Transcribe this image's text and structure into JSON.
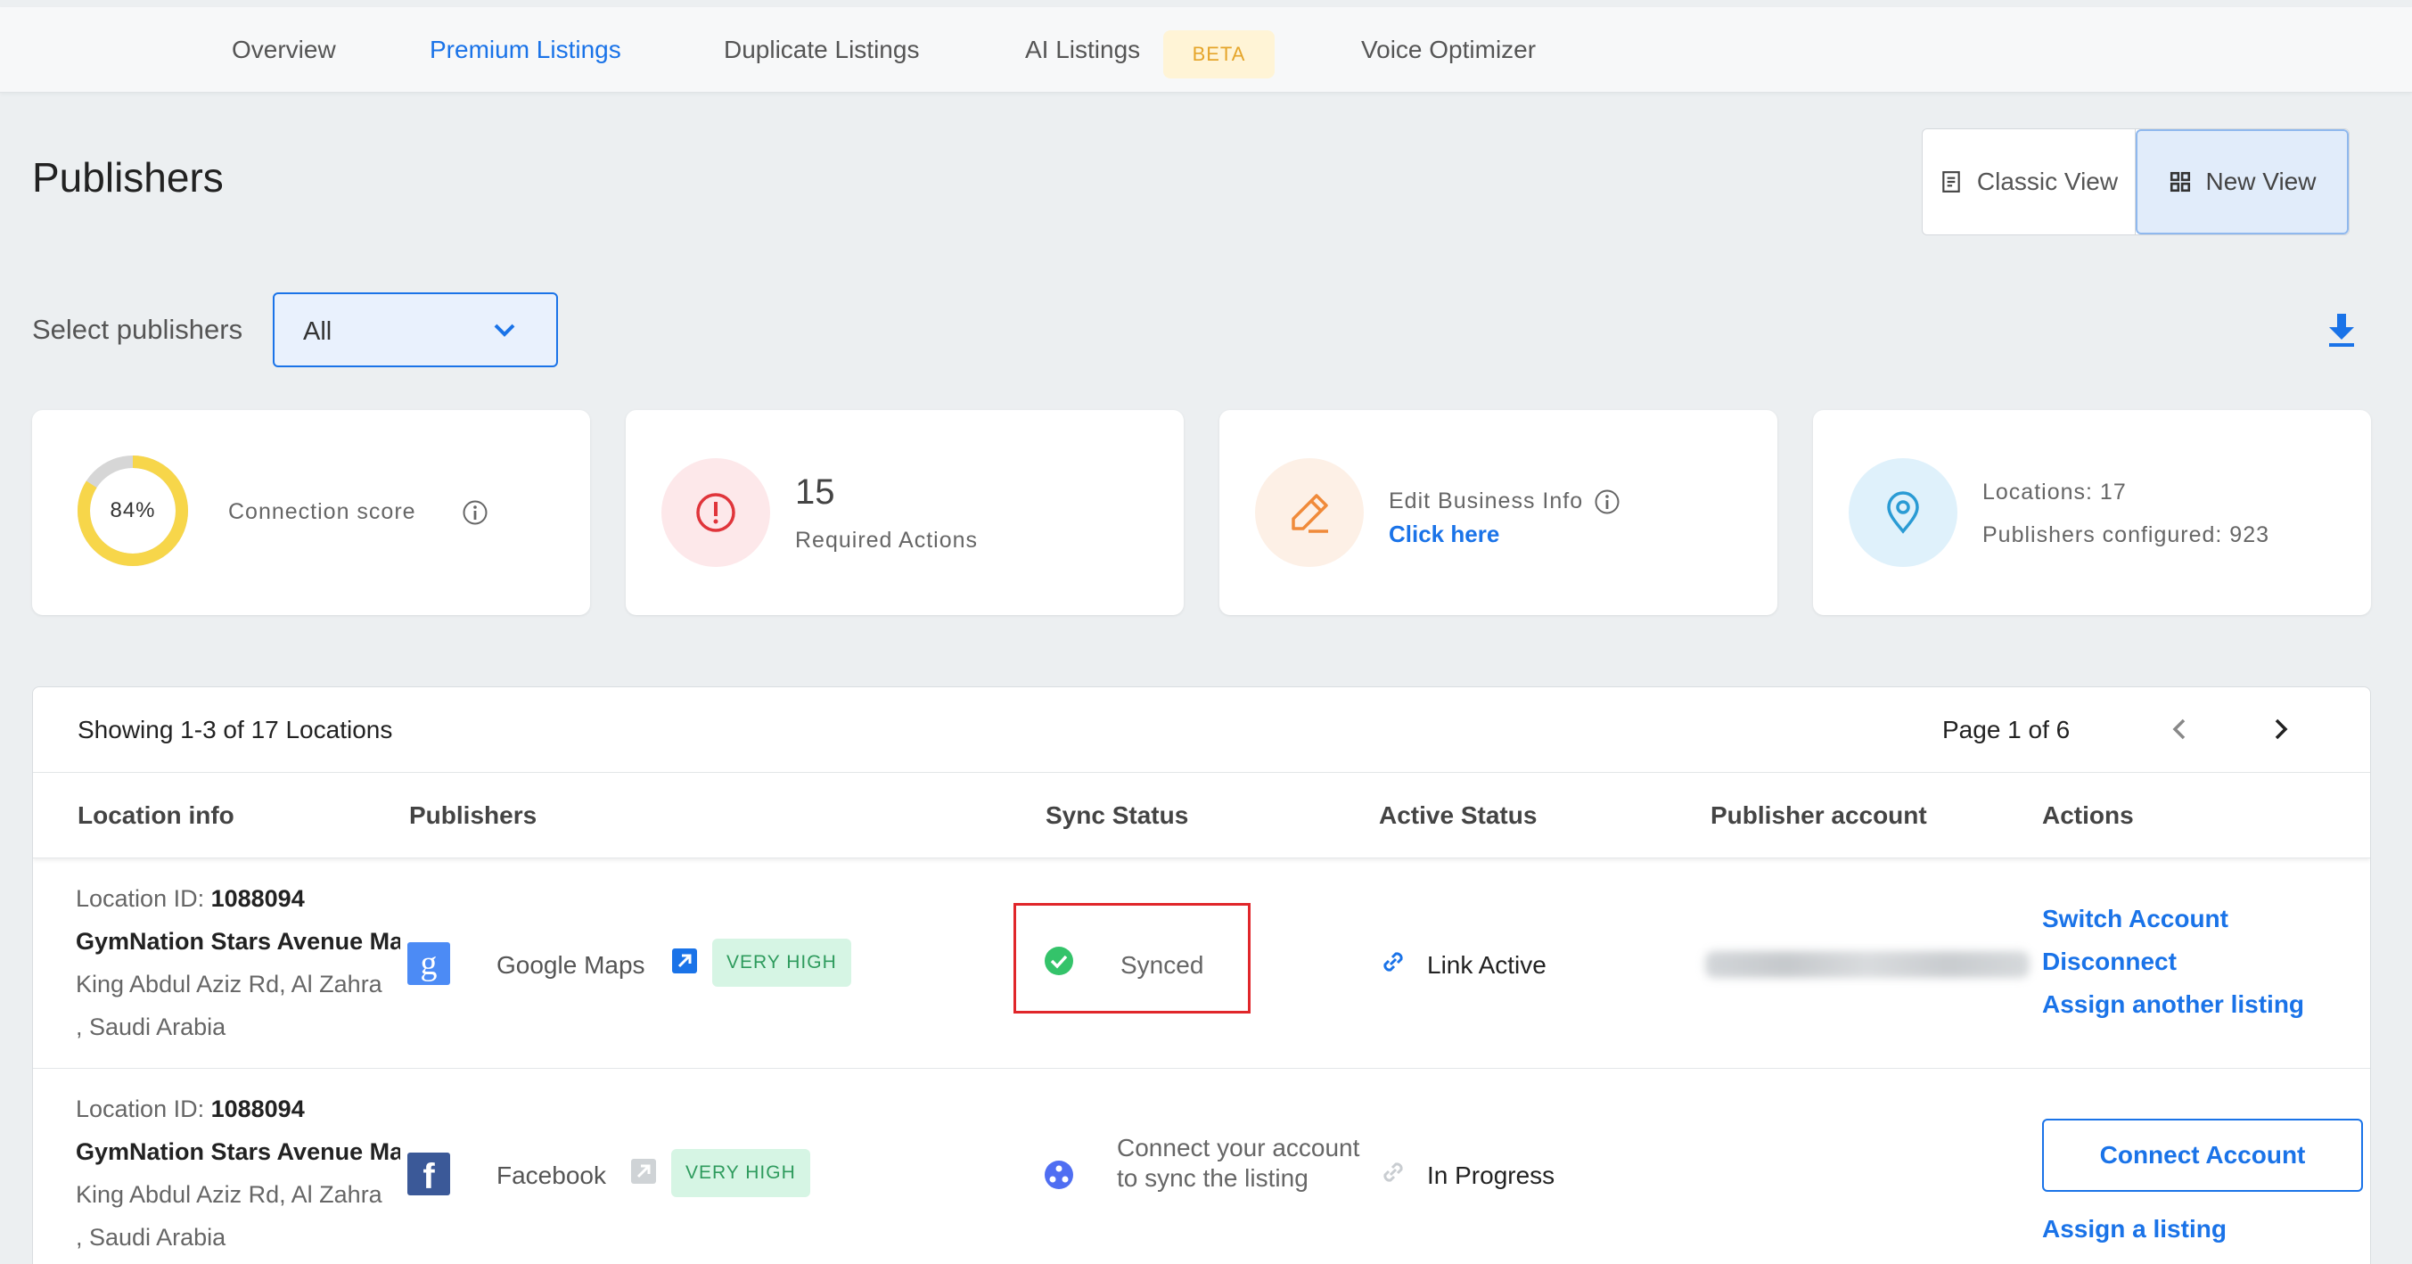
{
  "nav": {
    "tabs": [
      {
        "label": "Overview"
      },
      {
        "label": "Premium Listings"
      },
      {
        "label": "Duplicate Listings"
      },
      {
        "label": "AI Listings"
      },
      {
        "label": "Voice Optimizer"
      }
    ],
    "active_tab": "Premium Listings",
    "beta_badge": "BETA"
  },
  "page": {
    "title": "Publishers"
  },
  "view_toggle": {
    "classic": "Classic View",
    "new": "New View",
    "selected": "New View"
  },
  "filter": {
    "label": "Select publishers",
    "value": "All"
  },
  "stats": {
    "connection": {
      "percent_text": "84%",
      "percent": 84,
      "label": "Connection score"
    },
    "actions": {
      "count": "15",
      "label": "Required Actions"
    },
    "edit": {
      "label": "Edit Business Info",
      "link": "Click here"
    },
    "locations": {
      "locations": "Locations: 17",
      "publishers": "Publishers configured: 923"
    }
  },
  "table": {
    "showing": "Showing 1-3 of 17 Locations",
    "page": "Page 1 of 6",
    "columns": [
      "Location info",
      "Publishers",
      "Sync Status",
      "Active Status",
      "Publisher account",
      "Actions"
    ],
    "rows": [
      {
        "location_id_label": "Location ID: ",
        "location_id": "1088094",
        "name": "GymNation Stars Avenue Mall",
        "address": "King Abdul Aziz Rd, Al Zahra",
        "country": ", Saudi Arabia",
        "publisher": "Google Maps",
        "priority": "VERY HIGH",
        "sync_status": "Synced",
        "active_status": "Link Active",
        "actions": [
          "Switch Account",
          "Disconnect",
          "Assign another listing"
        ]
      },
      {
        "location_id_label": "Location ID: ",
        "location_id": "1088094",
        "name": "GymNation Stars Avenue Mall",
        "address": "King Abdul Aziz Rd, Al Zahra",
        "country": ", Saudi Arabia",
        "publisher": "Facebook",
        "priority": "VERY HIGH",
        "sync_status": "Connect your account to sync the listing",
        "active_status": "In Progress",
        "actions": [
          "Connect Account",
          "Assign a listing"
        ]
      }
    ]
  },
  "colors": {
    "accent": "#1a73e8",
    "donut": "#f7d64a",
    "highlight": "#e0262a",
    "synced": "#34c36a"
  }
}
